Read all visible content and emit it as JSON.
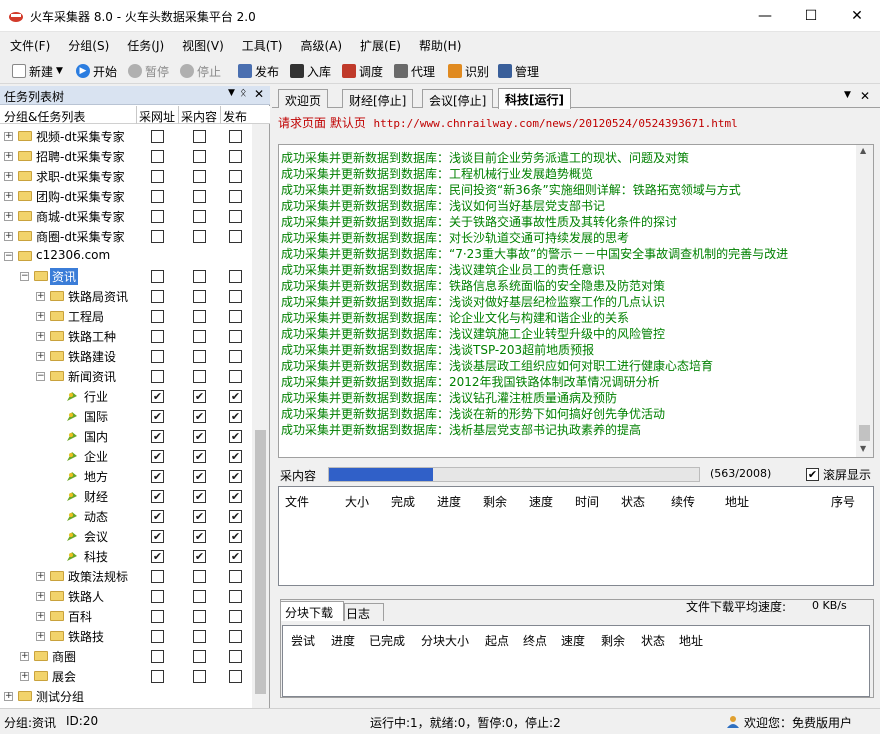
{
  "window": {
    "title": "火车采集器 8.0 - 火车头数据采集平台 2.0",
    "minimize": "—",
    "maximize": "☐",
    "close": "✕"
  },
  "menu": [
    "文件(F)",
    "分组(S)",
    "任务(J)",
    "视图(V)",
    "工具(T)",
    "高级(A)",
    "扩展(E)",
    "帮助(H)"
  ],
  "toolbar": {
    "new": "新建",
    "start": "开始",
    "pause": "暂停",
    "stop": "停止",
    "publish": "发布",
    "import": "入库",
    "schedule": "调度",
    "proxy": "代理",
    "recognize": "识别",
    "manage": "管理"
  },
  "left_panel": {
    "title": "任务列表树",
    "columns": [
      "分组&任务列表",
      "采网址",
      "采内容",
      "发布"
    ],
    "rows": [
      {
        "label": "视频-dt采集专家",
        "depth": 0,
        "exp": "+",
        "icon": "folder",
        "c": [
          false,
          false,
          false
        ]
      },
      {
        "label": "招聘-dt采集专家",
        "depth": 0,
        "exp": "+",
        "icon": "folder",
        "c": [
          false,
          false,
          false
        ]
      },
      {
        "label": "求职-dt采集专家",
        "depth": 0,
        "exp": "+",
        "icon": "folder",
        "c": [
          false,
          false,
          false
        ]
      },
      {
        "label": "团购-dt采集专家",
        "depth": 0,
        "exp": "+",
        "icon": "folder",
        "c": [
          false,
          false,
          false
        ]
      },
      {
        "label": "商城-dt采集专家",
        "depth": 0,
        "exp": "+",
        "icon": "folder",
        "c": [
          false,
          false,
          false
        ]
      },
      {
        "label": "商圈-dt采集专家",
        "depth": 0,
        "exp": "+",
        "icon": "folder",
        "c": [
          false,
          false,
          false
        ]
      },
      {
        "label": "c12306.com",
        "depth": 0,
        "exp": "−",
        "icon": "folder",
        "c": null
      },
      {
        "label": "资讯",
        "depth": 1,
        "exp": "−",
        "icon": "folder",
        "c": [
          false,
          false,
          false
        ],
        "selected": true
      },
      {
        "label": "铁路局资讯",
        "depth": 2,
        "exp": "+",
        "icon": "folder",
        "c": [
          false,
          false,
          false
        ]
      },
      {
        "label": "工程局",
        "depth": 2,
        "exp": "+",
        "icon": "folder",
        "c": [
          false,
          false,
          false
        ]
      },
      {
        "label": "铁路工种",
        "depth": 2,
        "exp": "+",
        "icon": "folder",
        "c": [
          false,
          false,
          false
        ]
      },
      {
        "label": "铁路建设",
        "depth": 2,
        "exp": "+",
        "icon": "folder",
        "c": [
          false,
          false,
          false
        ]
      },
      {
        "label": "新闻资讯",
        "depth": 2,
        "exp": "−",
        "icon": "folder",
        "c": [
          false,
          false,
          false
        ]
      },
      {
        "label": "行业",
        "depth": 3,
        "exp": "",
        "icon": "leaf",
        "c": [
          true,
          true,
          true
        ]
      },
      {
        "label": "国际",
        "depth": 3,
        "exp": "",
        "icon": "leaf",
        "c": [
          true,
          true,
          true
        ]
      },
      {
        "label": "国内",
        "depth": 3,
        "exp": "",
        "icon": "leaf",
        "c": [
          true,
          true,
          true
        ]
      },
      {
        "label": "企业",
        "depth": 3,
        "exp": "",
        "icon": "leaf",
        "c": [
          true,
          true,
          true
        ]
      },
      {
        "label": "地方",
        "depth": 3,
        "exp": "",
        "icon": "leaf",
        "c": [
          true,
          true,
          true
        ]
      },
      {
        "label": "财经",
        "depth": 3,
        "exp": "",
        "icon": "leaf",
        "c": [
          true,
          true,
          true
        ]
      },
      {
        "label": "动态",
        "depth": 3,
        "exp": "",
        "icon": "leaf",
        "c": [
          true,
          true,
          true
        ]
      },
      {
        "label": "会议",
        "depth": 3,
        "exp": "",
        "icon": "leaf",
        "c": [
          true,
          true,
          true
        ]
      },
      {
        "label": "科技",
        "depth": 3,
        "exp": "",
        "icon": "leaf",
        "c": [
          true,
          true,
          true
        ]
      },
      {
        "label": "政策法规标",
        "depth": 2,
        "exp": "+",
        "icon": "folder",
        "c": [
          false,
          false,
          false
        ]
      },
      {
        "label": "铁路人",
        "depth": 2,
        "exp": "+",
        "icon": "folder",
        "c": [
          false,
          false,
          false
        ]
      },
      {
        "label": "百科",
        "depth": 2,
        "exp": "+",
        "icon": "folder",
        "c": [
          false,
          false,
          false
        ]
      },
      {
        "label": "铁路技",
        "depth": 2,
        "exp": "+",
        "icon": "folder",
        "c": [
          false,
          false,
          false
        ]
      },
      {
        "label": "商圈",
        "depth": 1,
        "exp": "+",
        "icon": "folder",
        "c": [
          false,
          false,
          false
        ]
      },
      {
        "label": "展会",
        "depth": 1,
        "exp": "+",
        "icon": "folder",
        "c": [
          false,
          false,
          false
        ]
      },
      {
        "label": "测试分组",
        "depth": 0,
        "exp": "+",
        "icon": "folder",
        "c": null
      }
    ]
  },
  "tabs": [
    "欢迎页",
    "财经[停止]",
    "会议[停止]",
    "科技[运行]"
  ],
  "request": {
    "label": "请求页面 默认页",
    "url": "http://www.chnrailway.com/news/20120524/0524393671.html"
  },
  "log_prefix": "成功采集并更新数据到数据库：",
  "log_items": [
    "浅谈目前企业劳务派遣工的现状、问题及对策",
    "工程机械行业发展趋势概览",
    "民间投资“新36条”实施细则详解：铁路拓宽领域与方式",
    "浅议如何当好基层党支部书记",
    "关于铁路交通事故性质及其转化条件的探讨",
    "对长沙轨道交通可持续发展的思考",
    "“7·23重大事故”的警示－－中国安全事故调查机制的完善与改进",
    "浅议建筑企业员工的责任意识",
    "铁路信息系统面临的安全隐患及防范对策",
    "浅谈对做好基层纪检监察工作的几点认识",
    "论企业文化与构建和谐企业的关系",
    "浅议建筑施工企业转型升级中的风险管控",
    "浅谈TSP-203超前地质预报",
    "浅谈基层政工组织应如何对职工进行健康心态培育",
    "2012年我国铁路体制改革情况调研分析",
    "浅议钻孔灌注桩质量通病及预防",
    "浅谈在新的形势下如何搞好创先争优活动",
    "浅析基层党支部书记执政素养的提高"
  ],
  "progress": {
    "label": "采内容",
    "text": "(563/2008)",
    "fraction": 0.28,
    "autoscroll": "滚屏显示",
    "autoscroll_checked": true
  },
  "download_grid": {
    "columns": [
      "文件",
      "大小",
      "完成",
      "进度",
      "剩余",
      "速度",
      "时间",
      "状态",
      "续传",
      "地址",
      "序号"
    ]
  },
  "bottom_tabs": [
    "分块下载",
    "日志"
  ],
  "speed": {
    "label": "文件下载平均速度:",
    "value": "0 KB/s"
  },
  "block_grid": {
    "columns": [
      "尝试",
      "进度",
      "已完成",
      "分块大小",
      "起点",
      "终点",
      "速度",
      "剩余",
      "状态",
      "地址"
    ]
  },
  "status": {
    "group": "分组:资讯",
    "id": "ID:20",
    "running": "运行中:1，就绪:0，暂停:0，停止:2",
    "welcome": "欢迎您：免费版用户"
  },
  "colors": {
    "accent": "#3b7dd8",
    "log_text": "#008000",
    "url_text": "#c00000",
    "progress": "#3060c8"
  }
}
